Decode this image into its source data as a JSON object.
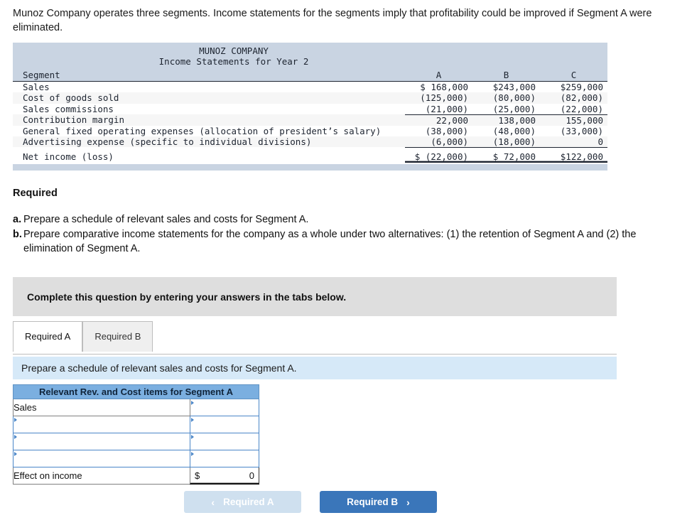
{
  "intro": "Munoz Company operates three segments. Income statements for the segments imply that profitability could be improved if Segment A were eliminated.",
  "statement": {
    "company": "MUNOZ COMPANY",
    "subtitle": "Income Statements for Year 2",
    "label_header": "Segment",
    "columns": [
      "A",
      "B",
      "C"
    ],
    "rows": [
      {
        "label": "Sales",
        "values": [
          "$ 168,000",
          "$243,000",
          "$259,000"
        ],
        "rule": "none"
      },
      {
        "label": "Cost of goods sold",
        "values": [
          "(125,000)",
          "(80,000)",
          "(82,000)"
        ],
        "rule": "none"
      },
      {
        "label": "Sales commissions",
        "values": [
          "(21,000)",
          "(25,000)",
          "(22,000)"
        ],
        "rule": "single"
      },
      {
        "label": "Contribution margin",
        "values": [
          "22,000",
          "138,000",
          "155,000"
        ],
        "rule": "none"
      },
      {
        "label": "General fixed operating expenses (allocation of president’s salary)",
        "values": [
          "(38,000)",
          "(48,000)",
          "(33,000)"
        ],
        "rule": "none"
      },
      {
        "label": "Advertising expense (specific to individual divisions)",
        "values": [
          "(6,000)",
          "(18,000)",
          "0"
        ],
        "rule": "single"
      },
      {
        "label": "Net income (loss)",
        "values": [
          "$ (22,000)",
          "$ 72,000",
          "$122,000"
        ],
        "rule": "double"
      }
    ]
  },
  "required": {
    "heading": "Required",
    "items": [
      {
        "marker": "a.",
        "text": "Prepare a schedule of relevant sales and costs for Segment A."
      },
      {
        "marker": "b.",
        "text": "Prepare comparative income statements for the company as a whole under two alternatives: (1) the retention of Segment A and (2) the elimination of Segment A."
      }
    ]
  },
  "complete_banner": "Complete this question by entering your answers in the tabs below.",
  "tabs": [
    {
      "label": "Required A",
      "active": true
    },
    {
      "label": "Required B",
      "active": false
    }
  ],
  "instruction": "Prepare a schedule of relevant sales and costs for Segment A.",
  "answer_table": {
    "header": "Relevant Rev. and Cost items for Segment A",
    "rows": [
      {
        "label": "Sales",
        "label_editable": false,
        "value": "",
        "value_editable": true,
        "total": false
      },
      {
        "label": "",
        "label_editable": true,
        "value": "",
        "value_editable": true,
        "total": false
      },
      {
        "label": "",
        "label_editable": true,
        "value": "",
        "value_editable": true,
        "total": false
      },
      {
        "label": "",
        "label_editable": true,
        "value": "",
        "value_editable": true,
        "total": false
      },
      {
        "label": "Effect on income",
        "label_editable": false,
        "currency": "$",
        "value": "0",
        "value_editable": false,
        "total": true
      }
    ]
  },
  "nav": {
    "prev_label": "Required A",
    "next_label": "Required B",
    "prev_chevron": "‹",
    "next_chevron": "›"
  },
  "colors": {
    "statement_band": "#c9d4e2",
    "answer_header_blue": "#7bafe0",
    "instruction_blue": "#d6e9f8",
    "complete_grey": "#dedede",
    "next_button_blue": "#3a76ba",
    "prev_button_blue": "#cfe0ef",
    "input_border_blue": "#4a86c8"
  }
}
